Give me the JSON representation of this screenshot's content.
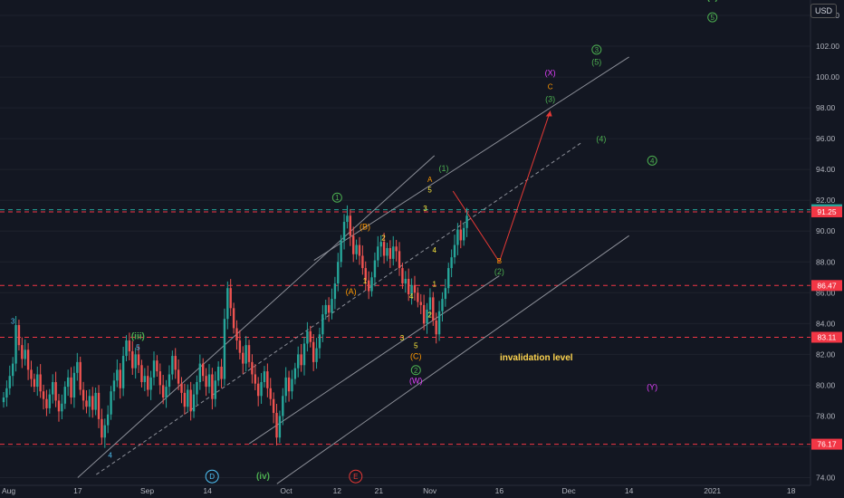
{
  "currency_label": "USD",
  "chart_data": {
    "type": "candlestick",
    "yticks": [
      74.0,
      76.0,
      78.0,
      80.0,
      82.0,
      84.0,
      86.0,
      88.0,
      90.0,
      92.0,
      94.0,
      96.0,
      98.0,
      100.0,
      102.0,
      104.0
    ],
    "ylim": [
      73.5,
      105.0
    ],
    "xticks": [
      "Aug",
      "17",
      "Sep",
      "14",
      "Oct",
      "12",
      "21",
      "Nov",
      "16",
      "Dec",
      "14",
      "2021",
      "18"
    ],
    "price_lines": [
      {
        "value": 91.39,
        "color": "#26a69a",
        "label": "91.39"
      },
      {
        "value": 91.25,
        "color": "#f23645",
        "label": "91.25"
      },
      {
        "value": 86.47,
        "color": "#f23645",
        "label": "86.47"
      },
      {
        "value": 83.11,
        "color": "#f23645",
        "label": "83.11"
      },
      {
        "value": 76.17,
        "color": "#f23645",
        "label": "76.17"
      }
    ],
    "series": [
      {
        "values": [
          79.2,
          79.8,
          80.6,
          81.4,
          83.9,
          82.6,
          81.7,
          82.3,
          81.0,
          80.4,
          79.9,
          80.7,
          79.6,
          79.1,
          78.5,
          79.4,
          80.2,
          79.0,
          78.3,
          78.8,
          79.9,
          80.5,
          79.2,
          80.8,
          81.5,
          79.7,
          79.0,
          78.6,
          79.3,
          78.4,
          79.5,
          77.8,
          76.6,
          77.4,
          78.1,
          79.6,
          80.3,
          81.0,
          79.8,
          81.9,
          82.9,
          82.2,
          81.1,
          82.0,
          81.3,
          80.2,
          80.6,
          79.7,
          80.5,
          81.6,
          80.9,
          80.0,
          79.2,
          79.9,
          80.7,
          81.9,
          81.0,
          80.1,
          79.5,
          78.6,
          79.7,
          78.3,
          79.4,
          80.2,
          81.4,
          80.6,
          79.9,
          80.7,
          79.1,
          80.3,
          81.2,
          80.4,
          84.3,
          86.3,
          85.0,
          83.7,
          82.9,
          82.1,
          81.4,
          82.6,
          81.5,
          80.7,
          80.1,
          79.3,
          80.2,
          80.9,
          79.8,
          79.1,
          78.2,
          76.6,
          78.0,
          79.3,
          80.5,
          79.6,
          80.4,
          81.1,
          82.0,
          81.3,
          82.7,
          83.5,
          82.8,
          81.5,
          82.4,
          83.3,
          84.6,
          85.2,
          84.7,
          85.6,
          86.6,
          88.0,
          89.4,
          90.6,
          91.0,
          89.7,
          88.5,
          89.1,
          88.4,
          87.6,
          86.8,
          86.1,
          87.0,
          88.1,
          89.0,
          89.3,
          88.4,
          88.9,
          88.2,
          89.0,
          88.7,
          87.6,
          86.6,
          86.9,
          85.9,
          86.5,
          86.0,
          85.4,
          85.2,
          84.0,
          84.9,
          85.7,
          84.2,
          83.3,
          84.8,
          85.6,
          86.3,
          87.6,
          88.3,
          89.1,
          90.1,
          89.4,
          90.2,
          91.0
        ]
      }
    ],
    "trendlines": [
      {
        "from": [
          "8/17",
          74.0
        ],
        "to": [
          "Nov 2",
          94.9
        ],
        "color": "#8c8f98",
        "dash": false
      },
      {
        "from": [
          "Sep 23",
          76.2
        ],
        "to": [
          "Nov 16",
          87.1
        ],
        "color": "#8c8f98",
        "dash": false
      },
      {
        "from": [
          "Oct 7",
          88.1
        ],
        "to": [
          "Dec 14",
          101.3
        ],
        "color": "#8c8f98",
        "dash": false
      },
      {
        "from": [
          "Sep 29",
          73.6
        ],
        "to": [
          "Dec 14",
          89.7
        ],
        "color": "#8c8f98",
        "dash": false
      },
      {
        "from": [
          "8/21",
          74.2
        ],
        "to": [
          "Dec 4",
          95.8
        ],
        "color": "#8c8f98",
        "dash": true
      },
      {
        "from": [
          "Nov 6",
          92.6
        ],
        "to": [
          "Nov 16",
          88.0
        ],
        "color": "#e53935",
        "dash": false
      },
      {
        "from": [
          "Nov 16",
          88.0
        ],
        "to": [
          "Nov 27",
          97.8
        ],
        "color": "#e53935",
        "dash": false
      }
    ],
    "annotations": [
      {
        "text": "(v)",
        "color": "#4caf50",
        "circle": false,
        "x": "Jan 1",
        "y": 105.0
      },
      {
        "text": "5",
        "color": "#4caf50",
        "circle": true,
        "x": "Jan 1",
        "y": 103.7
      },
      {
        "text": "3",
        "color": "#4caf50",
        "circle": true,
        "x": "Dec 7",
        "y": 101.6
      },
      {
        "text": "(5)",
        "color": "#4caf50",
        "circle": false,
        "x": "Dec 7",
        "y": 100.8
      },
      {
        "text": "(X)",
        "color": "#e040fb",
        "circle": false,
        "x": "Nov 27",
        "y": 100.1
      },
      {
        "text": "C",
        "color": "#ff9800",
        "circle": false,
        "x": "Nov 27",
        "y": 99.2
      },
      {
        "text": "(3)",
        "color": "#4caf50",
        "circle": false,
        "x": "Nov 27",
        "y": 98.4
      },
      {
        "text": "(4)",
        "color": "#4caf50",
        "circle": false,
        "x": "Dec 8",
        "y": 95.8
      },
      {
        "text": "4",
        "color": "#4caf50",
        "circle": true,
        "x": "Dec 19",
        "y": 94.4
      },
      {
        "text": "(1)",
        "color": "#4caf50",
        "circle": false,
        "x": "Nov 4",
        "y": 93.9
      },
      {
        "text": "A",
        "color": "#ff9800",
        "circle": false,
        "x": "Nov 1",
        "y": 93.2
      },
      {
        "text": "5",
        "color": "#ffeb3b",
        "circle": false,
        "x": "Nov 1",
        "y": 92.5
      },
      {
        "text": "1",
        "color": "#4caf50",
        "circle": true,
        "x": "Oct 12",
        "y": 92.0
      },
      {
        "text": "3",
        "color": "#ffeb3b",
        "circle": false,
        "x": "Oct 31",
        "y": 91.3
      },
      {
        "text": "(B)",
        "color": "#ff9800",
        "circle": false,
        "x": "Oct 18",
        "y": 90.1
      },
      {
        "text": "2",
        "color": "#ffeb3b",
        "circle": false,
        "x": "Oct 22",
        "y": 89.4
      },
      {
        "text": "4",
        "color": "#ffeb3b",
        "circle": false,
        "x": "Nov 2",
        "y": 88.6
      },
      {
        "text": "B",
        "color": "#ff9800",
        "circle": false,
        "x": "Nov 16",
        "y": 87.9
      },
      {
        "text": "(2)",
        "color": "#4caf50",
        "circle": false,
        "x": "Nov 16",
        "y": 87.2
      },
      {
        "text": "1",
        "color": "#ffeb3b",
        "circle": false,
        "x": "Oct 18",
        "y": 86.6
      },
      {
        "text": "1",
        "color": "#ffeb3b",
        "circle": false,
        "x": "Nov 2",
        "y": 86.4
      },
      {
        "text": "(A)",
        "color": "#ff9800",
        "circle": false,
        "x": "Oct 15",
        "y": 85.9
      },
      {
        "text": "4",
        "color": "#ffeb3b",
        "circle": false,
        "x": "Oct 28",
        "y": 85.6
      },
      {
        "text": "2",
        "color": "#ffeb3b",
        "circle": false,
        "x": "Nov 1",
        "y": 84.4
      },
      {
        "text": "3",
        "color": "#4fc3f7",
        "circle": false,
        "x": "8/3",
        "y": 84.0
      },
      {
        "text": "(iii)",
        "color": "#4caf50",
        "circle": false,
        "x": "Aug 30",
        "y": 83.0
      },
      {
        "text": "5",
        "color": "#4fc3f7",
        "circle": false,
        "x": "Aug 30",
        "y": 82.3
      },
      {
        "text": "3",
        "color": "#ffeb3b",
        "circle": false,
        "x": "Oct 26",
        "y": 82.9
      },
      {
        "text": "5",
        "color": "#ffeb3b",
        "circle": false,
        "x": "Oct 29",
        "y": 82.4
      },
      {
        "text": "(C)",
        "color": "#ff9800",
        "circle": false,
        "x": "Oct 29",
        "y": 81.7
      },
      {
        "text": "invalidation level",
        "color": "#ffd54f",
        "circle": false,
        "x": "Nov 24",
        "y": 81.6
      },
      {
        "text": "2",
        "color": "#4caf50",
        "circle": true,
        "x": "Oct 29",
        "y": 80.8
      },
      {
        "text": "(W)",
        "color": "#e040fb",
        "circle": false,
        "x": "Oct 29",
        "y": 80.1
      },
      {
        "text": "(Y)",
        "color": "#e040fb",
        "circle": false,
        "x": "Dec 19",
        "y": 79.7
      },
      {
        "text": "4",
        "color": "#4fc3f7",
        "circle": false,
        "x": "8/24",
        "y": 75.3
      },
      {
        "text": "D",
        "color": "#4fc3f7",
        "circle": true,
        "x": "Sep 15",
        "y": 73.9
      },
      {
        "text": "(iv)",
        "color": "#4caf50",
        "circle": false,
        "x": "Sep 26",
        "y": 73.9
      },
      {
        "text": "E",
        "color": "#e53935",
        "circle": true,
        "x": "Oct 16",
        "y": 73.9
      }
    ]
  }
}
